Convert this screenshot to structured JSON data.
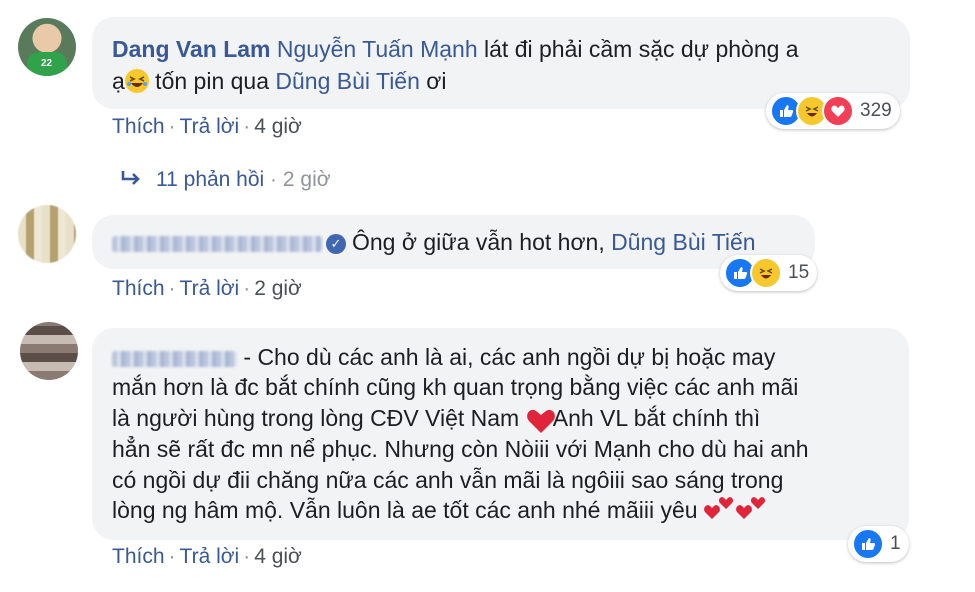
{
  "comments": [
    {
      "author": "Dang Van Lam",
      "segments": {
        "mention1": "Nguyễn Tuấn Mạnh",
        "text1": " lát đi phải cầm sặc dự phòng a",
        "text2": "ạ",
        "text3": " tốn pin qua ",
        "mention2": "Dũng Bùi Tiến",
        "text4": " ơi"
      },
      "actions": {
        "like": "Thích",
        "reply": "Trả lời",
        "time": "4 giờ"
      },
      "reactions": {
        "icons": [
          "like-icon",
          "haha-icon",
          "love-icon"
        ],
        "count": "329"
      },
      "replies": {
        "label": "11 phản hồi",
        "time": "2 giờ"
      }
    },
    {
      "author_blurred": true,
      "segments": {
        "text1": "Ông ở giữa vẫn hot hơn, ",
        "mention1": "Dũng Bùi Tiến"
      },
      "actions": {
        "like": "Thích",
        "reply": "Trả lời",
        "time": "2 giờ"
      },
      "reactions": {
        "icons": [
          "like-icon",
          "haha-icon"
        ],
        "count": "15"
      }
    },
    {
      "author_blurred": true,
      "lines": {
        "l1": " - Cho dù các anh là ai, các anh ngồi dự bị hoặc may",
        "l2": "mắn hơn là đc bắt chính cũng kh quan trọng bằng việc các anh mãi",
        "l3a": "là người hùng trong lòng CĐV Việt Nam ",
        "l3b": " Anh VL bắt chính thì",
        "l4": "hẳn sẽ rất đc mn nể phục. Nhưng còn Nòiii với Mạnh cho dù hai anh",
        "l5": "có ngồi dự đii chăng nữa các anh vẫn mãi là ngôiii sao sáng trong",
        "l6": "lòng ng hâm mộ. Vẫn luôn là ae tốt các anh nhé mãiii yêu "
      },
      "actions": {
        "like": "Thích",
        "reply": "Trả lời",
        "time": "4 giờ"
      },
      "reactions": {
        "icons": [
          "like-icon"
        ],
        "count": "1"
      }
    }
  ],
  "colors": {
    "link": "#385898",
    "bubble": "#f2f3f5",
    "like": "#1877f2",
    "haha": "#f7c82d",
    "love": "#f33e58"
  }
}
